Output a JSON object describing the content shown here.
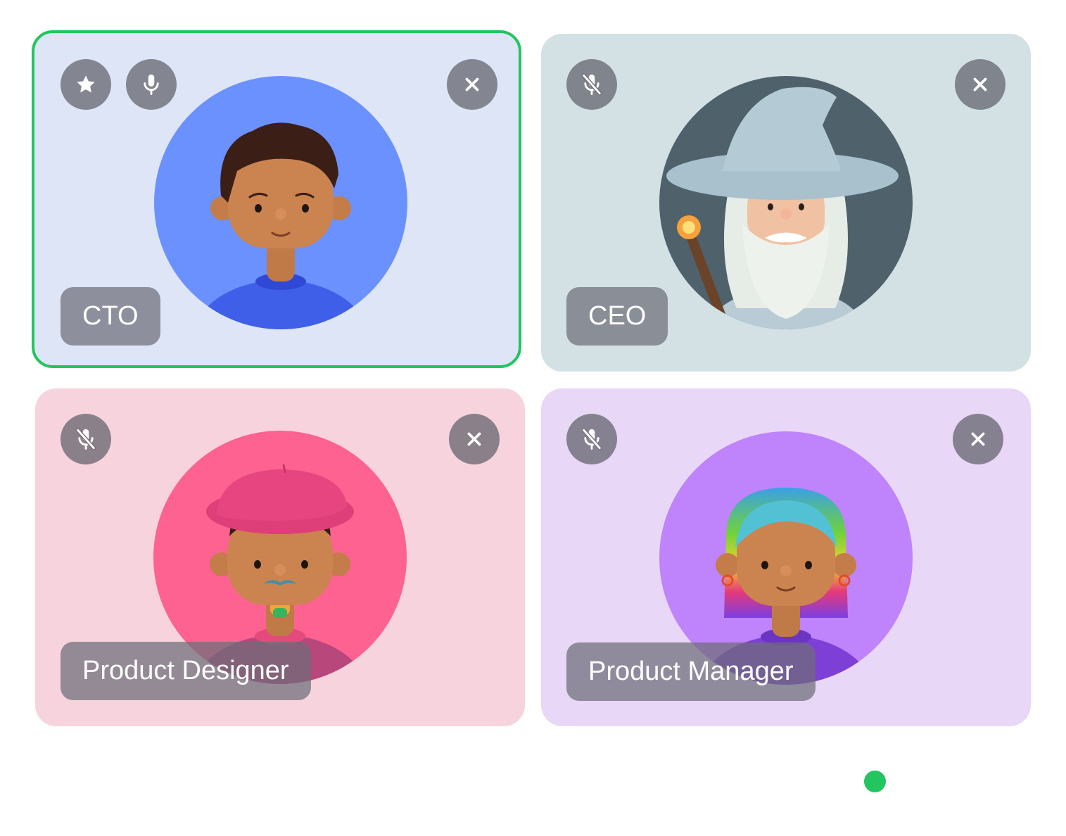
{
  "participants": [
    {
      "name": "CTO",
      "tile_color": "#dde5f7",
      "avatar_bg": "#6a91fd",
      "mic": "on",
      "pinned": true,
      "active_speaker": true,
      "icons": [
        "star-icon",
        "mic-icon",
        "close-icon"
      ]
    },
    {
      "name": "CEO",
      "tile_color": "#d3e1e5",
      "avatar_bg": "#4f616b",
      "mic": "muted",
      "pinned": false,
      "active_speaker": false,
      "icons": [
        "mic-off-icon",
        "close-icon"
      ]
    },
    {
      "name": "Product Designer",
      "tile_color": "#f6d3dd",
      "avatar_bg": "#fe6290",
      "mic": "muted",
      "pinned": false,
      "active_speaker": false,
      "icons": [
        "mic-off-icon",
        "close-icon"
      ]
    },
    {
      "name": "Product Manager",
      "tile_color": "#e8d7f6",
      "avatar_bg": "#bf83fc",
      "mic": "muted",
      "pinned": false,
      "active_speaker": false,
      "icons": [
        "mic-off-icon",
        "close-icon"
      ]
    }
  ],
  "pagination": {
    "current_page": 1,
    "dot_color": "#22c55e"
  },
  "colors": {
    "active_border": "#22c55e",
    "control_bg": "#5f5f69",
    "label_text": "#ffffff"
  }
}
